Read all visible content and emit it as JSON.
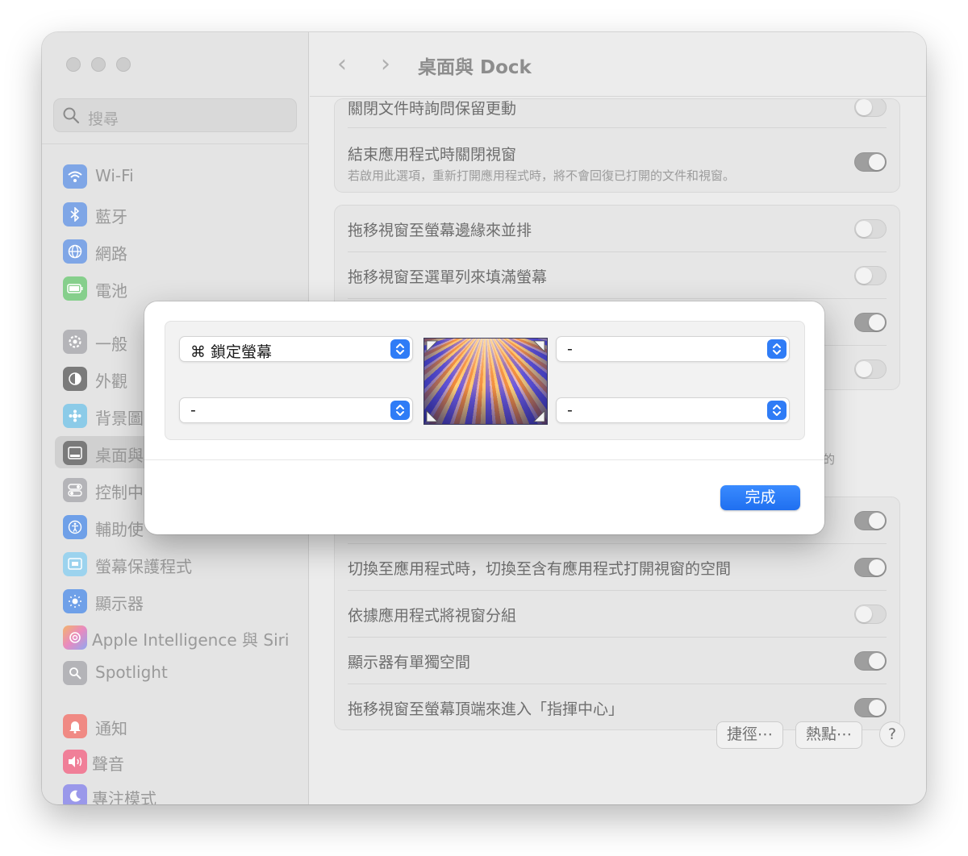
{
  "window": {
    "title": "桌面與 Dock",
    "search_placeholder": "搜尋"
  },
  "sidebar": {
    "items": [
      {
        "label": "Wi-Fi",
        "icon": "wifi-icon",
        "color": "#3b82f6"
      },
      {
        "label": "藍牙",
        "icon": "bluetooth-icon",
        "color": "#3b82f6"
      },
      {
        "label": "網路",
        "icon": "globe-icon",
        "color": "#3b82f6"
      },
      {
        "label": "電池",
        "icon": "battery-icon",
        "color": "#34c759"
      },
      {
        "label": "一般",
        "icon": "gear-icon",
        "color": "#8e8e93"
      },
      {
        "label": "外觀",
        "icon": "appearance-icon",
        "color": "#1c1c1e"
      },
      {
        "label": "背景圖",
        "icon": "wallpaper-icon",
        "color": "#32ade6"
      },
      {
        "label": "桌面與",
        "icon": "dock-icon",
        "color": "#1c1c1e"
      },
      {
        "label": "控制中",
        "icon": "control-center-icon",
        "color": "#8e8e93"
      },
      {
        "label": "輔助使",
        "icon": "accessibility-icon",
        "color": "#007aff"
      },
      {
        "label": "螢幕保護程式",
        "icon": "screensaver-icon",
        "color": "#5ac8fa"
      },
      {
        "label": "顯示器",
        "icon": "display-icon",
        "color": "#0a84ff"
      },
      {
        "label": "Apple Intelligence 與 Siri",
        "icon": "siri-icon",
        "color": "#ff9f0a"
      },
      {
        "label": "Spotlight",
        "icon": "spotlight-icon",
        "color": "#8e8e93"
      },
      {
        "label": "通知",
        "icon": "notification-icon",
        "color": "#ff3b30"
      },
      {
        "label": "聲音",
        "icon": "sound-icon",
        "color": "#ff2d55"
      },
      {
        "label": "專注模式",
        "icon": "focus-icon",
        "color": "#5e5ce6"
      }
    ]
  },
  "settings": {
    "group1": [
      {
        "label": "關閉文件時詢問保留更動",
        "on": false
      },
      {
        "label": "結束應用程式時關閉視窗",
        "sub": "若啟用此選項，重新打開應用程式時，將不會回復已打開的文件和視窗。",
        "on": true
      }
    ],
    "group2": [
      {
        "label": "拖移視窗至螢幕邊緣來並排",
        "on": false
      },
      {
        "label": "拖移視窗至選單列來填滿螢幕",
        "on": false
      }
    ],
    "group3": [
      {
        "label": "切換至應用程式時，切換至含有應用程式打開視窗的空間",
        "on": true
      },
      {
        "label": "依據應用程式將視窗分組",
        "on": false
      },
      {
        "label": "顯示器有單獨空間",
        "on": true
      },
      {
        "label": "拖移視窗至螢幕頂端來進入「指揮中心」",
        "on": true
      }
    ],
    "cut_fragment": "的"
  },
  "bottom_buttons": {
    "shortcuts": "捷徑⋯",
    "hot_corners": "熱點⋯",
    "help": "?"
  },
  "hot_corner_sheet": {
    "top_left": "⌘ 鎖定螢幕",
    "top_right": "-",
    "bottom_left": "-",
    "bottom_right": "-",
    "done": "完成"
  }
}
